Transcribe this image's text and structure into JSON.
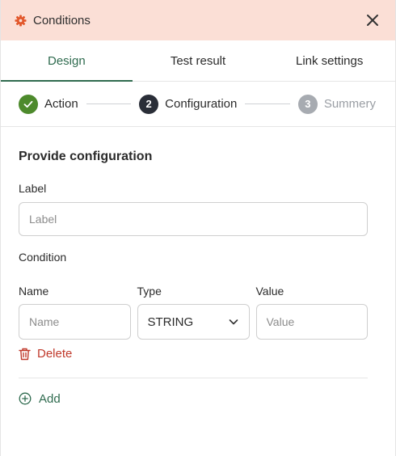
{
  "header": {
    "title": "Conditions",
    "logo_icon": "gear-icon",
    "close_icon": "close-icon"
  },
  "tabs": [
    {
      "label": "Design",
      "active": true
    },
    {
      "label": "Test result",
      "active": false
    },
    {
      "label": "Link settings",
      "active": false
    }
  ],
  "stepper": {
    "steps": [
      {
        "label": "Action",
        "state": "done",
        "number": ""
      },
      {
        "label": "Configuration",
        "state": "current",
        "number": "2"
      },
      {
        "label": "Summery",
        "state": "todo",
        "number": "3"
      }
    ]
  },
  "form": {
    "section_title": "Provide configuration",
    "label_field": {
      "label": "Label",
      "placeholder": "Label",
      "value": ""
    },
    "condition_title": "Condition",
    "condition": {
      "name": {
        "label": "Name",
        "placeholder": "Name",
        "value": ""
      },
      "type": {
        "label": "Type",
        "value": "STRING"
      },
      "value": {
        "label": "Value",
        "placeholder": "Value",
        "value": ""
      }
    },
    "delete_label": "Delete",
    "add_label": "Add"
  },
  "colors": {
    "header_bg": "#fbdfd6",
    "accent": "#2f6b4f",
    "done": "#4d8a2c",
    "danger": "#c0392b",
    "logo": "#e2572b"
  }
}
